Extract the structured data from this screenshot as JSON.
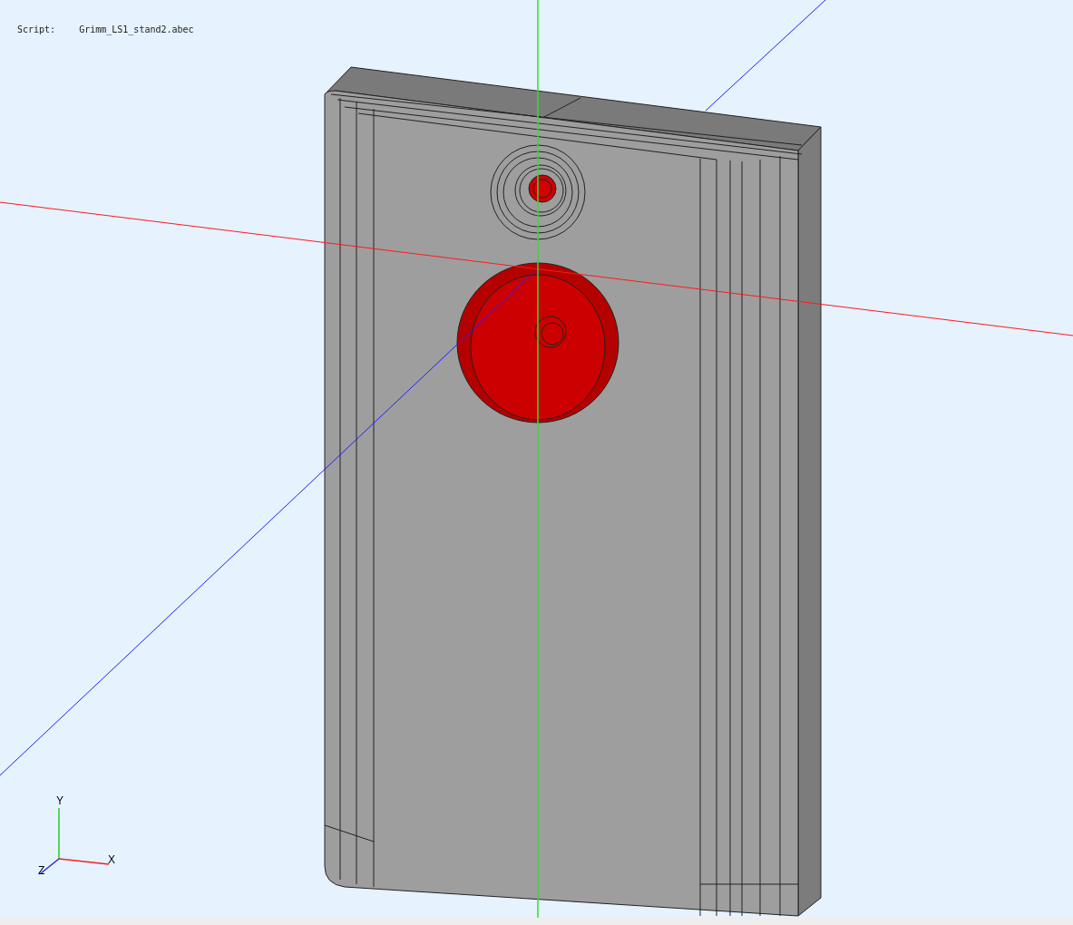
{
  "viewport": {
    "script_label": "Script:",
    "script_name": "Grimm_LS1_stand2.abec"
  },
  "axis_triad": {
    "x_label": "X",
    "y_label": "Y",
    "z_label": "Z"
  }
}
